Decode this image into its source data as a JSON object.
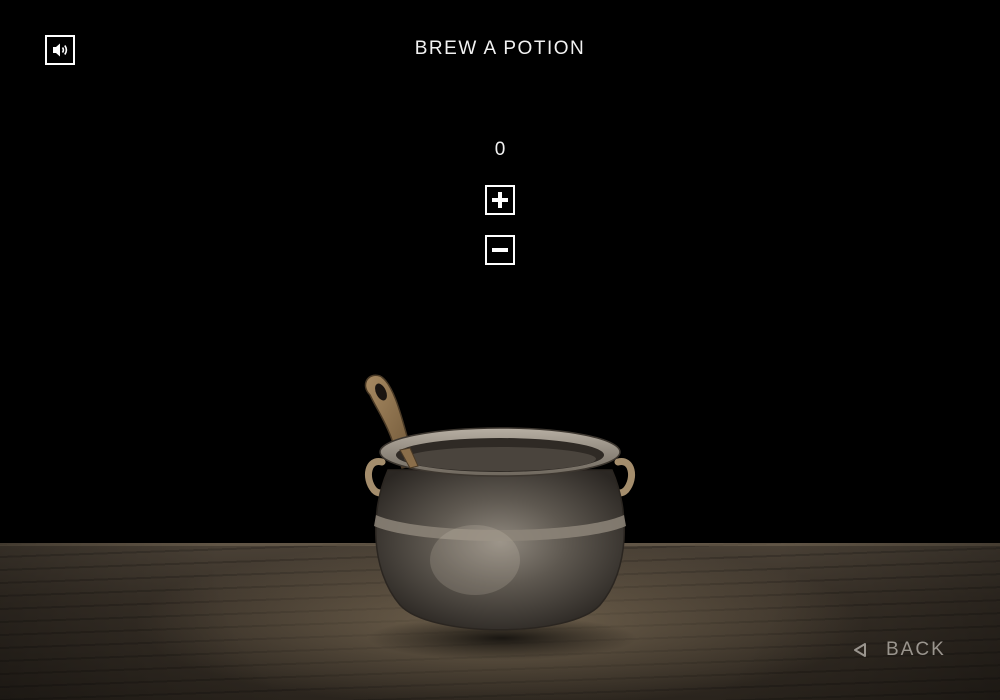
{
  "header": {
    "title": "BREW A POTION",
    "sound_icon": "speaker-volume-icon"
  },
  "brew": {
    "count": "0",
    "increment_icon": "plus-icon",
    "decrement_icon": "minus-icon"
  },
  "scene": {
    "cauldron": "cauldron-with-spoon",
    "background": "wooden-table"
  },
  "navigation": {
    "back_label": "BACK",
    "back_icon": "triangle-left-icon"
  },
  "colors": {
    "background": "#000000",
    "text": "#f2f2f2",
    "back_text": "#9a958e",
    "table": "#3a3229"
  }
}
